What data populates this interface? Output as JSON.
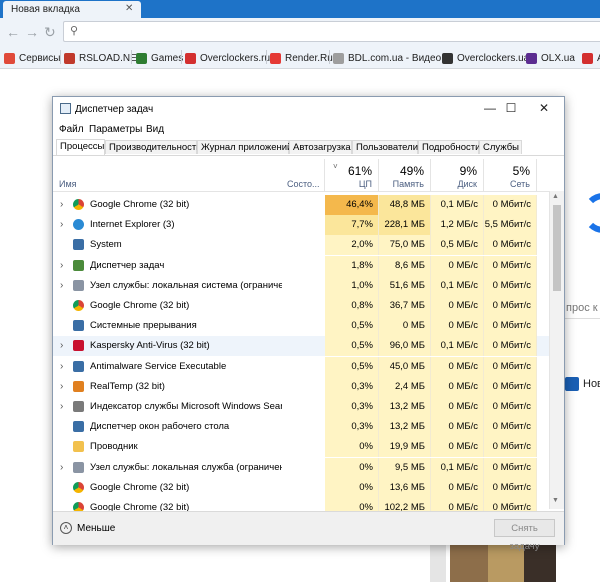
{
  "browser": {
    "tab_title": "Новая вкладка",
    "tab_close": "✕",
    "nav": {
      "back": "←",
      "forward": "→",
      "reload": "↻"
    },
    "omnibox_icon": "search-icon",
    "bookmarks": [
      {
        "label": "Сервисы",
        "icon": "apps-grid-icon",
        "color": "#e04a3a"
      },
      {
        "label": "RSLOAD.NET",
        "icon": "site-icon",
        "color": "#c0392b"
      },
      {
        "label": "Games",
        "icon": "site-icon",
        "color": "#2e7d32"
      },
      {
        "label": "Overclockers.ru",
        "icon": "site-icon",
        "color": "#d32f2f"
      },
      {
        "label": "Render.Ru",
        "icon": "site-icon",
        "color": "#e53935"
      },
      {
        "label": "BDL.com.ua - Видео...",
        "icon": "page-icon",
        "color": "#9e9e9e"
      },
      {
        "label": "Overclockers.ua",
        "icon": "site-icon",
        "color": "#333333"
      },
      {
        "label": "OLX.ua",
        "icon": "site-icon",
        "color": "#5c2d91"
      },
      {
        "label": "Au",
        "icon": "site-icon",
        "color": "#d32f2f"
      }
    ],
    "page_snippets": {
      "search_hint": "прос к",
      "news_label": "Нов"
    }
  },
  "task_manager": {
    "title": "Диспетчер задач",
    "window_buttons": {
      "minimize": "—",
      "maximize": "☐",
      "close": "✕"
    },
    "menu": [
      "Файл",
      "Параметры",
      "Вид"
    ],
    "tabs": [
      "Процессы",
      "Производительность",
      "Журнал приложений",
      "Автозагрузка",
      "Пользователи",
      "Подробности",
      "Службы"
    ],
    "active_tab": 0,
    "columns": {
      "name": "Имя",
      "status": "Состо...",
      "cpu": {
        "pct": "61%",
        "label": "ЦП"
      },
      "memory": {
        "pct": "49%",
        "label": "Память"
      },
      "disk": {
        "pct": "9%",
        "label": "Диск"
      },
      "network": {
        "pct": "5%",
        "label": "Сеть"
      }
    },
    "rows": [
      {
        "name": "Google Chrome (32 bit)",
        "icon": "chrome-icon",
        "expand": true,
        "cpu": "46,4%",
        "mem": "48,8 МБ",
        "disk": "0,1 МБ/с",
        "net": "0 Мбит/с",
        "heat": 4
      },
      {
        "name": "Internet Explorer (3)",
        "icon": "ie-icon",
        "expand": true,
        "cpu": "7,7%",
        "mem": "228,1 МБ",
        "disk": "1,2 МБ/с",
        "net": "5,5 Мбит/с",
        "heat": 2
      },
      {
        "name": "System",
        "icon": "window-icon",
        "expand": false,
        "cpu": "2,0%",
        "mem": "75,0 МБ",
        "disk": "0,5 МБ/с",
        "net": "0 Мбит/с",
        "heat": 1
      },
      {
        "name": "Диспетчер задач",
        "icon": "taskmgr-icon",
        "expand": true,
        "cpu": "1,8%",
        "mem": "8,6 МБ",
        "disk": "0 МБ/с",
        "net": "0 Мбит/с",
        "heat": 1
      },
      {
        "name": "Узел службы: локальная система (ограничен...",
        "icon": "gear-icon",
        "expand": true,
        "cpu": "1,0%",
        "mem": "51,6 МБ",
        "disk": "0,1 МБ/с",
        "net": "0 Мбит/с",
        "heat": 1
      },
      {
        "name": "Google Chrome (32 bit)",
        "icon": "chrome-icon",
        "expand": false,
        "cpu": "0,8%",
        "mem": "36,7 МБ",
        "disk": "0 МБ/с",
        "net": "0 Мбит/с",
        "heat": 1
      },
      {
        "name": "Системные прерывания",
        "icon": "window-icon",
        "expand": false,
        "cpu": "0,5%",
        "mem": "0 МБ",
        "disk": "0 МБ/с",
        "net": "0 Мбит/с",
        "heat": 1
      },
      {
        "name": "Kaspersky Anti-Virus (32 bit)",
        "icon": "kaspersky-icon",
        "expand": true,
        "cpu": "0,5%",
        "mem": "96,0 МБ",
        "disk": "0,1 МБ/с",
        "net": "0 Мбит/с",
        "heat": 1,
        "selected": true
      },
      {
        "name": "Antimalware Service Executable",
        "icon": "window-icon",
        "expand": true,
        "cpu": "0,5%",
        "mem": "45,0 МБ",
        "disk": "0 МБ/с",
        "net": "0 Мбит/с",
        "heat": 1
      },
      {
        "name": "RealTemp (32 bit)",
        "icon": "realtemp-icon",
        "expand": true,
        "cpu": "0,3%",
        "mem": "2,4 МБ",
        "disk": "0 МБ/с",
        "net": "0 Мбит/с",
        "heat": 1
      },
      {
        "name": "Индексатор службы Microsoft Windows Search",
        "icon": "search-indexer-icon",
        "expand": true,
        "cpu": "0,3%",
        "mem": "13,2 МБ",
        "disk": "0 МБ/с",
        "net": "0 Мбит/с",
        "heat": 1
      },
      {
        "name": "Диспетчер окон рабочего стола",
        "icon": "window-icon",
        "expand": false,
        "cpu": "0,3%",
        "mem": "13,2 МБ",
        "disk": "0 МБ/с",
        "net": "0 Мбит/с",
        "heat": 1
      },
      {
        "name": "Проводник",
        "icon": "explorer-icon",
        "expand": false,
        "cpu": "0%",
        "mem": "19,9 МБ",
        "disk": "0 МБ/с",
        "net": "0 Мбит/с",
        "heat": 1
      },
      {
        "name": "Узел службы: локальная служба (ограничени...",
        "icon": "gear-icon",
        "expand": true,
        "cpu": "0%",
        "mem": "9,5 МБ",
        "disk": "0,1 МБ/с",
        "net": "0 Мбит/с",
        "heat": 1
      },
      {
        "name": "Google Chrome (32 bit)",
        "icon": "chrome-icon",
        "expand": false,
        "cpu": "0%",
        "mem": "13,6 МБ",
        "disk": "0 МБ/с",
        "net": "0 Мбит/с",
        "heat": 1
      },
      {
        "name": "Google Chrome (32 bit)",
        "icon": "chrome-icon",
        "expand": false,
        "cpu": "0%",
        "mem": "102,2 МБ",
        "disk": "0 МБ/с",
        "net": "0 Мбит/с",
        "heat": 1
      }
    ],
    "footer": {
      "fewer_label": "Меньше",
      "fewer_icon": "chevron-up-circle-icon",
      "end_task_label": "Снять задачу"
    },
    "colors": {
      "heat_low": "#fff4c4",
      "heat_mid": "#fbe69b",
      "heat_high": "#f9d36c",
      "heat_max": "#f4b84c",
      "selected_row": "#eef4fb"
    }
  }
}
